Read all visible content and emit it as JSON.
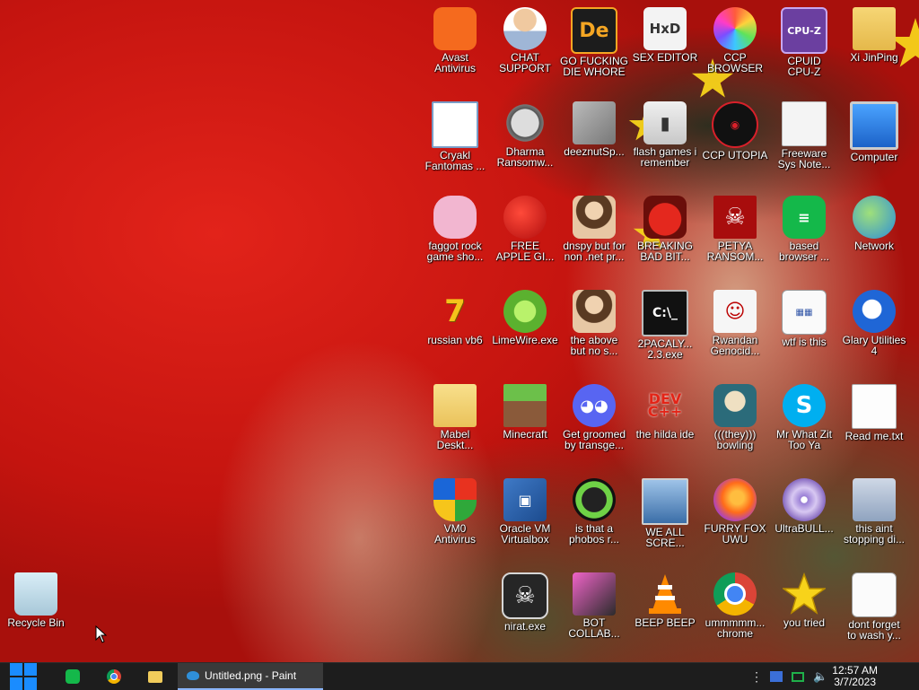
{
  "desktop": {
    "icons": [
      {
        "label": "Avast\nAntivirus",
        "icon": "avast-icon"
      },
      {
        "label": "CHAT\nSUPPORT",
        "icon": "support-person-icon"
      },
      {
        "label": "GO FUCKING\nDIE WHORE",
        "icon": "de-app-icon"
      },
      {
        "label": "SEX EDITOR",
        "icon": "hxd-editor-icon"
      },
      {
        "label": "CCP\nBROWSER",
        "icon": "ccp-browser-icon"
      },
      {
        "label": "CPUID\nCPU-Z",
        "icon": "cpuz-icon"
      },
      {
        "label": "Xi JinPing",
        "icon": "user-folder-icon"
      },
      {
        "label": "Cryakl\nFantomas ...",
        "icon": "window-app-icon"
      },
      {
        "label": "Dharma\nRansomw...",
        "icon": "skull-mask-icon"
      },
      {
        "label": "deeznutSp...",
        "icon": "layered-windows-icon"
      },
      {
        "label": "flash games i\nremember",
        "icon": "flash-folder-icon"
      },
      {
        "label": "CCP UTOPIA",
        "icon": "ccp-utopia-icon"
      },
      {
        "label": "Freeware\nSys Note...",
        "icon": "document-icon"
      },
      {
        "label": "Computer",
        "icon": "computer-icon"
      },
      {
        "label": "faggot rock\ngame sho...",
        "icon": "pink-pig-icon"
      },
      {
        "label": "FREE\nAPPLE GI...",
        "icon": "apple-icon"
      },
      {
        "label": "dnspy but for\nnon .net pr...",
        "icon": "portrait-lady-icon"
      },
      {
        "label": "BREAKING\nBAD BIT...",
        "icon": "angry-bird-icon"
      },
      {
        "label": "PETYA\nRANSOM...",
        "icon": "petya-skull-icon"
      },
      {
        "label": "based\nbrowser ...",
        "icon": "green-chat-icon"
      },
      {
        "label": "Network",
        "icon": "network-globe-icon"
      },
      {
        "label": "russian vb6",
        "icon": "seven-zip-icon"
      },
      {
        "label": "LimeWire.exe",
        "icon": "limewire-icon"
      },
      {
        "label": "the above\nbut no s...",
        "icon": "portrait-lady-six-icon"
      },
      {
        "label": "2PACALY...\n2.3.exe",
        "icon": "command-prompt-icon"
      },
      {
        "label": "Rwandan\nGenocid...",
        "icon": "meme-face-icon"
      },
      {
        "label": "wtf is this",
        "icon": "grid-document-icon"
      },
      {
        "label": "Glary Utilities\n4",
        "icon": "glary-icon"
      },
      {
        "label": "Mabel\nDeskt...",
        "icon": "document-folder-icon"
      },
      {
        "label": "Minecraft",
        "icon": "minecraft-icon"
      },
      {
        "label": "Get groomed\nby transge...",
        "icon": "discord-icon"
      },
      {
        "label": "the hilda ide",
        "icon": "dev-cpp-icon"
      },
      {
        "label": "(((they)))\nbowling",
        "icon": "santa-icon"
      },
      {
        "label": "Mr What Zit\nToo Ya",
        "icon": "skype-icon"
      },
      {
        "label": "Read me.txt",
        "icon": "text-file-icon"
      },
      {
        "label": "VM0\nAntivirus",
        "icon": "security-shield-icon"
      },
      {
        "label": "Oracle VM\nVirtualbox",
        "icon": "virtualbox-icon"
      },
      {
        "label": "is that a\nphobos r...",
        "icon": "icq-flower-icon"
      },
      {
        "label": "WE ALL\nSCRE...",
        "icon": "old-computer-icon"
      },
      {
        "label": "FURRY FOX\nUWU",
        "icon": "firefox-icon"
      },
      {
        "label": "UltraBULL...",
        "icon": "disc-icon"
      },
      {
        "label": "this aint\nstopping di...",
        "icon": "printer-icon"
      },
      {
        "label": "Recycle Bin",
        "icon": "recycle-bin-icon"
      },
      {
        "label": "nirat.exe",
        "icon": "skull-icon"
      },
      {
        "label": "BOT\nCOLLAB...",
        "icon": "bot-collab-icon"
      },
      {
        "label": "BEEP BEEP",
        "icon": "vlc-cone-icon"
      },
      {
        "label": "ummmmm...\nchrome",
        "icon": "chrome-icon"
      },
      {
        "label": "you tried",
        "icon": "star-icon"
      },
      {
        "label": "dont forget\nto wash y...",
        "icon": "grid-document-icon"
      }
    ]
  },
  "taskbar": {
    "start_icon": "windows-logo-icon",
    "pinned": [
      "green-chat-icon",
      "chrome-icon",
      "folder-icon"
    ],
    "active_task": {
      "label": "Untitled.png - Paint",
      "icon": "paint-icon"
    },
    "tray_icons": [
      "overflow-dots-icon",
      "flag-icon",
      "network-icon",
      "speaker-muted-icon"
    ],
    "time": "12:57 AM",
    "date": "3/7/2023"
  },
  "colors": {
    "background_red": "#c4140f",
    "star_yellow": "#f7d31a",
    "taskbar": "#1d1d1d",
    "windows_blue": "#1a8cff"
  }
}
